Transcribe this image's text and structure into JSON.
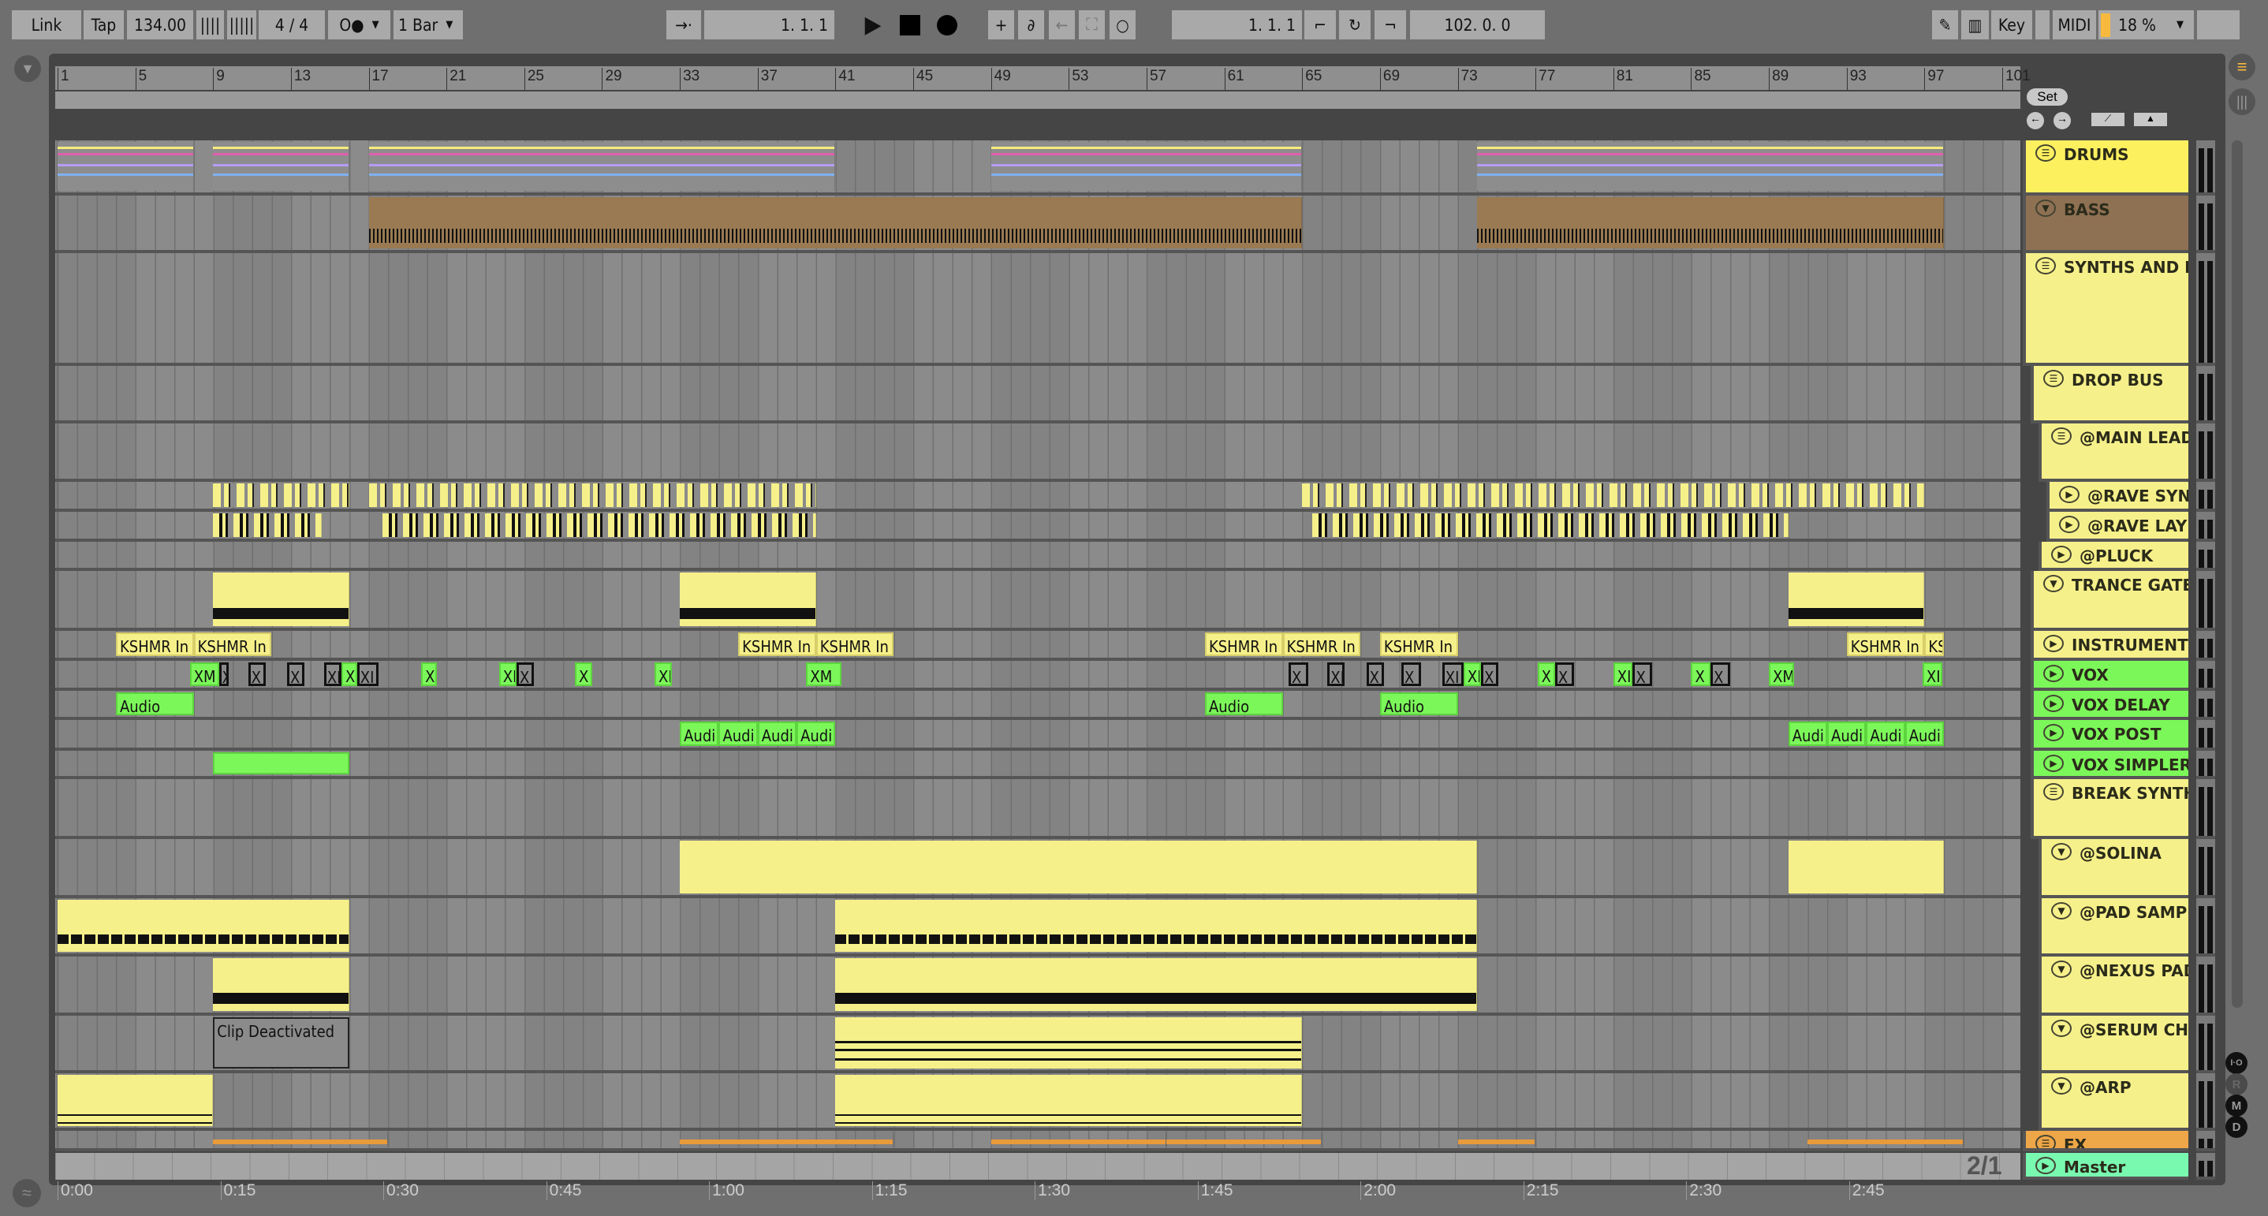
{
  "toolbar": {
    "link": "Link",
    "tap": "Tap",
    "tempo": "134.00",
    "signature": "4 / 4",
    "metronome": "O●",
    "quantize": "1 Bar",
    "position": "1.  1.  1",
    "loop_start": "1.  1.  1",
    "loop_length": "102.  0.  0",
    "key": "Key",
    "midi": "MIDI",
    "cpu": "18 %"
  },
  "colors": {
    "yellow": "#f6f08a",
    "drums": "#fdf05f",
    "bass": "#8e7052",
    "green": "#7cf75a",
    "fx": "#eda648",
    "master": "#79f8b0"
  },
  "ruler": {
    "bars": [
      "1",
      "5",
      "9",
      "13",
      "17",
      "21",
      "25",
      "29",
      "33",
      "37",
      "41",
      "45",
      "49",
      "53",
      "57",
      "61",
      "65",
      "69",
      "73",
      "77",
      "81",
      "85",
      "89",
      "93",
      "97",
      "101"
    ]
  },
  "time_ruler": {
    "labels": [
      "0:00",
      "0:15",
      "0:30",
      "0:45",
      "1:00",
      "1:15",
      "1:30",
      "1:45",
      "2:00",
      "2:15",
      "2:30",
      "2:45"
    ],
    "seconds_per_label": 15,
    "tempo_bpm": 134
  },
  "right_panel": {
    "set": "Set",
    "io": "I·O",
    "r": "R",
    "m": "M",
    "d": "D",
    "zoom_ratio": "2/1"
  },
  "tracks": [
    {
      "name": "DRUMS",
      "icon": "group",
      "color": "#fdf05f",
      "level": 0,
      "clips": [
        [
          1,
          8,
          "drum",
          ""
        ],
        [
          9,
          16,
          "drum",
          ""
        ],
        [
          17,
          41,
          "drum",
          ""
        ],
        [
          49,
          65,
          "drum",
          ""
        ],
        [
          74,
          98,
          "drum",
          ""
        ]
      ]
    },
    {
      "name": "BASS",
      "icon": "fold",
      "color": "#8e7052",
      "level": 0,
      "clips": [
        [
          17,
          65,
          "bass",
          ""
        ],
        [
          74,
          98,
          "bass",
          ""
        ]
      ]
    },
    {
      "name": "SYNTHS AND INS",
      "icon": "group",
      "color": "#f6f08a",
      "level": 0,
      "clips": []
    },
    {
      "name": "DROP BUS",
      "icon": "group",
      "color": "#f6f08a",
      "level": 1,
      "clips": []
    },
    {
      "name": "@MAIN LEAD",
      "icon": "group",
      "color": "#f6f08a",
      "level": 2,
      "clips": []
    },
    {
      "name": "@RAVE SYNT",
      "icon": "play",
      "color": "#f6f08a",
      "level": 3,
      "clips": [
        [
          9,
          16,
          "stutter",
          ""
        ],
        [
          17,
          40,
          "stutter",
          ""
        ],
        [
          65,
          97,
          "stutter",
          ""
        ]
      ]
    },
    {
      "name": "@RAVE LAYER",
      "icon": "play",
      "color": "#f6f08a",
      "level": 3,
      "clips": [
        [
          9,
          14.6,
          "black",
          ""
        ],
        [
          17.7,
          40,
          "black",
          ""
        ],
        [
          65.5,
          90,
          "black",
          ""
        ]
      ]
    },
    {
      "name": "@PLUCK",
      "icon": "play",
      "color": "#f6f08a",
      "level": 2,
      "clips": []
    },
    {
      "name": "TRANCE GATE S",
      "icon": "fold",
      "color": "#f6f08a",
      "level": 1,
      "clips": [
        [
          9,
          16,
          "gate",
          ""
        ],
        [
          33,
          40,
          "gate",
          ""
        ],
        [
          90,
          97,
          "gate",
          ""
        ]
      ]
    },
    {
      "name": "INSTRUMENT R",
      "icon": "play",
      "color": "#f6f08a",
      "level": 1,
      "clips": [
        [
          4,
          8,
          "label",
          "KSHMR In"
        ],
        [
          8,
          12,
          "label",
          "KSHMR In"
        ],
        [
          36,
          40,
          "label",
          "KSHMR In"
        ],
        [
          40,
          44,
          "label",
          "KSHMR In"
        ],
        [
          60,
          64,
          "label",
          "KSHMR In"
        ],
        [
          64,
          68,
          "label",
          "KSHMR In"
        ],
        [
          69,
          73,
          "label",
          "KSHMR In"
        ],
        [
          93,
          97,
          "label",
          "KSHMR In"
        ],
        [
          97,
          98,
          "label",
          "KS"
        ]
      ]
    },
    {
      "name": "VOX",
      "icon": "play",
      "color": "#7cf75a",
      "level": 1,
      "clips": [
        [
          7.8,
          9.3,
          "audio",
          "XM"
        ],
        [
          9.3,
          9.8,
          "x",
          "X"
        ],
        [
          10.8,
          11.7,
          "x",
          "X"
        ],
        [
          12.8,
          13.7,
          "x",
          "X"
        ],
        [
          14.7,
          15.6,
          "x",
          "XI"
        ],
        [
          15.6,
          16.4,
          "audio",
          "XI"
        ],
        [
          16.4,
          17.5,
          "x",
          "XI"
        ],
        [
          19.7,
          20.5,
          "audio",
          "X"
        ],
        [
          23.7,
          24.6,
          "audio",
          "XI"
        ],
        [
          24.6,
          25.5,
          "x",
          "X"
        ],
        [
          27.6,
          28.5,
          "audio",
          "X"
        ],
        [
          31.7,
          32.6,
          "audio",
          "XI"
        ],
        [
          39.5,
          41.3,
          "audio",
          "XM"
        ],
        [
          64.3,
          65.3,
          "x",
          "X"
        ],
        [
          66.3,
          67.2,
          "x",
          "XI"
        ],
        [
          68.3,
          69.2,
          "x",
          "X"
        ],
        [
          70.1,
          71.1,
          "x",
          "X"
        ],
        [
          72.2,
          73.3,
          "x",
          "XI"
        ],
        [
          73.3,
          74.2,
          "audio",
          "XI"
        ],
        [
          74.2,
          75.1,
          "x",
          "X"
        ],
        [
          77.1,
          78,
          "audio",
          "X"
        ],
        [
          78,
          79,
          "x",
          "X"
        ],
        [
          81,
          82,
          "audio",
          "XI"
        ],
        [
          82,
          83,
          "x",
          "X"
        ],
        [
          85,
          86,
          "audio",
          "X"
        ],
        [
          86,
          87,
          "x",
          "X"
        ],
        [
          89,
          90.3,
          "audio",
          "XM"
        ],
        [
          96.9,
          97.9,
          "audio",
          "XI"
        ]
      ]
    },
    {
      "name": "VOX DELAY",
      "icon": "play",
      "color": "#7cf75a",
      "level": 1,
      "clips": [
        [
          4,
          8,
          "audio",
          "Audio"
        ],
        [
          60,
          64,
          "audio",
          "Audio"
        ],
        [
          69,
          73,
          "audio",
          "Audio"
        ]
      ]
    },
    {
      "name": "VOX POST",
      "icon": "play",
      "color": "#7cf75a",
      "level": 1,
      "clips": [
        [
          33,
          35,
          "audio",
          "Audi"
        ],
        [
          35,
          37,
          "audio",
          "Audi"
        ],
        [
          37,
          39,
          "audio",
          "Audi"
        ],
        [
          39,
          41,
          "audio",
          "Audi"
        ],
        [
          90,
          92,
          "audio",
          "Audi"
        ],
        [
          92,
          94,
          "audio",
          "Audi"
        ],
        [
          94,
          96,
          "audio",
          "Audi"
        ],
        [
          96,
          98,
          "audio",
          "Audi"
        ]
      ]
    },
    {
      "name": "VOX SIMPLER",
      "icon": "play",
      "color": "#7cf75a",
      "level": 1,
      "clips": [
        [
          9,
          16,
          "audio",
          ""
        ]
      ]
    },
    {
      "name": "BREAK SYNTHS",
      "icon": "group",
      "color": "#f6f08a",
      "level": 1,
      "clips": []
    },
    {
      "name": "@SOLINA",
      "icon": "fold",
      "color": "#f6f08a",
      "level": 2,
      "clips": [
        [
          33,
          74,
          "yellow",
          ""
        ],
        [
          90,
          98,
          "yellow",
          ""
        ]
      ]
    },
    {
      "name": "@PAD SAMPLE",
      "icon": "fold",
      "color": "#f6f08a",
      "level": 2,
      "clips": [
        [
          1,
          16,
          "pad",
          ""
        ],
        [
          41,
          74,
          "pad",
          ""
        ]
      ]
    },
    {
      "name": "@NEXUS PAD",
      "icon": "fold",
      "color": "#f6f08a",
      "level": 2,
      "clips": [
        [
          9,
          16,
          "nexus",
          ""
        ],
        [
          41,
          74,
          "nexus",
          ""
        ]
      ]
    },
    {
      "name": "@SERUM CHO",
      "icon": "fold",
      "color": "#f6f08a",
      "level": 2,
      "clips": [
        [
          9,
          16,
          "deact",
          "Clip Deactivated"
        ],
        [
          41,
          65,
          "serum",
          ""
        ]
      ]
    },
    {
      "name": "@ARP",
      "icon": "fold",
      "color": "#f6f08a",
      "level": 2,
      "clips": [
        [
          1,
          9,
          "arp",
          ""
        ],
        [
          41,
          65,
          "arp",
          ""
        ]
      ]
    },
    {
      "name": "FX",
      "icon": "group",
      "color": "#eda648",
      "level": 0,
      "clips": [
        [
          9,
          18,
          "fx",
          ""
        ],
        [
          33,
          44,
          "fx",
          ""
        ],
        [
          49,
          58,
          "fx",
          ""
        ],
        [
          58,
          66,
          "fx",
          ""
        ],
        [
          73,
          77,
          "fx",
          ""
        ],
        [
          91,
          99,
          "fx",
          ""
        ]
      ]
    },
    {
      "name": "Master",
      "icon": "play",
      "color": "#79f8b0",
      "level": 0,
      "clips": []
    }
  ]
}
